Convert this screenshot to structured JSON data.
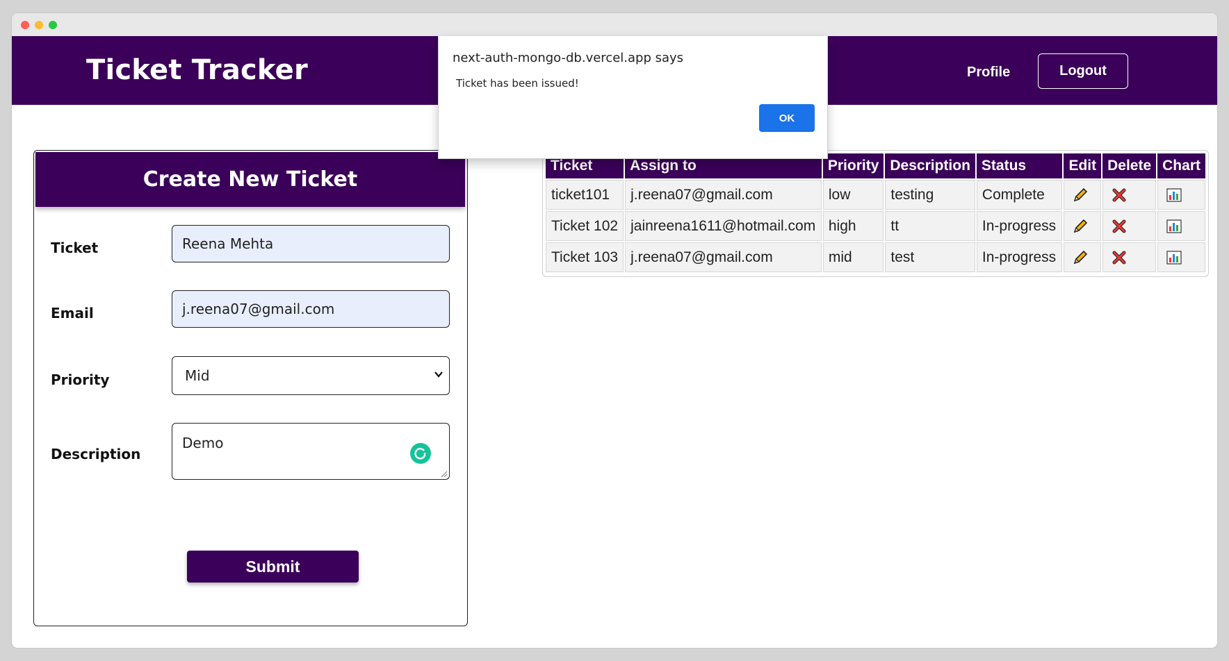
{
  "app": {
    "brand": "Ticket Tracker",
    "nav": {
      "profile_label": "Profile",
      "logout_label": "Logout"
    }
  },
  "form": {
    "title": "Create New Ticket",
    "fields": {
      "ticket": {
        "label": "Ticket",
        "value": "Reena Mehta"
      },
      "email": {
        "label": "Email",
        "value": "j.reena07@gmail.com"
      },
      "priority": {
        "label": "Priority",
        "value": "Mid"
      },
      "description": {
        "label": "Description",
        "value": "Demo"
      }
    },
    "submit_label": "Submit"
  },
  "table": {
    "headers": [
      "Ticket",
      "Assign to",
      "Priority",
      "Description",
      "Status",
      "Edit",
      "Delete",
      "Chart"
    ],
    "rows": [
      {
        "ticket": "ticket101",
        "assign_to": "j.reena07@gmail.com",
        "priority": "low",
        "description": "testing",
        "status": "Complete"
      },
      {
        "ticket": "Ticket 102",
        "assign_to": "jainreena1611@hotmail.com",
        "priority": "high",
        "description": "tt",
        "status": "In-progress"
      },
      {
        "ticket": "Ticket 103",
        "assign_to": "j.reena07@gmail.com",
        "priority": "mid",
        "description": "test",
        "status": "In-progress"
      }
    ],
    "row_icons": {
      "edit": "pencil-icon",
      "delete": "red-x-icon",
      "chart": "bar-chart-icon"
    }
  },
  "dialog": {
    "origin": "next-auth-mongo-db.vercel.app says",
    "message": "Ticket has been issued!",
    "ok_label": "OK"
  },
  "colors": {
    "brand_purple": "#3b0059",
    "dialog_ok_blue": "#1a73e8",
    "autofill_blue": "#e8eefc",
    "grammarly_green": "#15c39a"
  }
}
